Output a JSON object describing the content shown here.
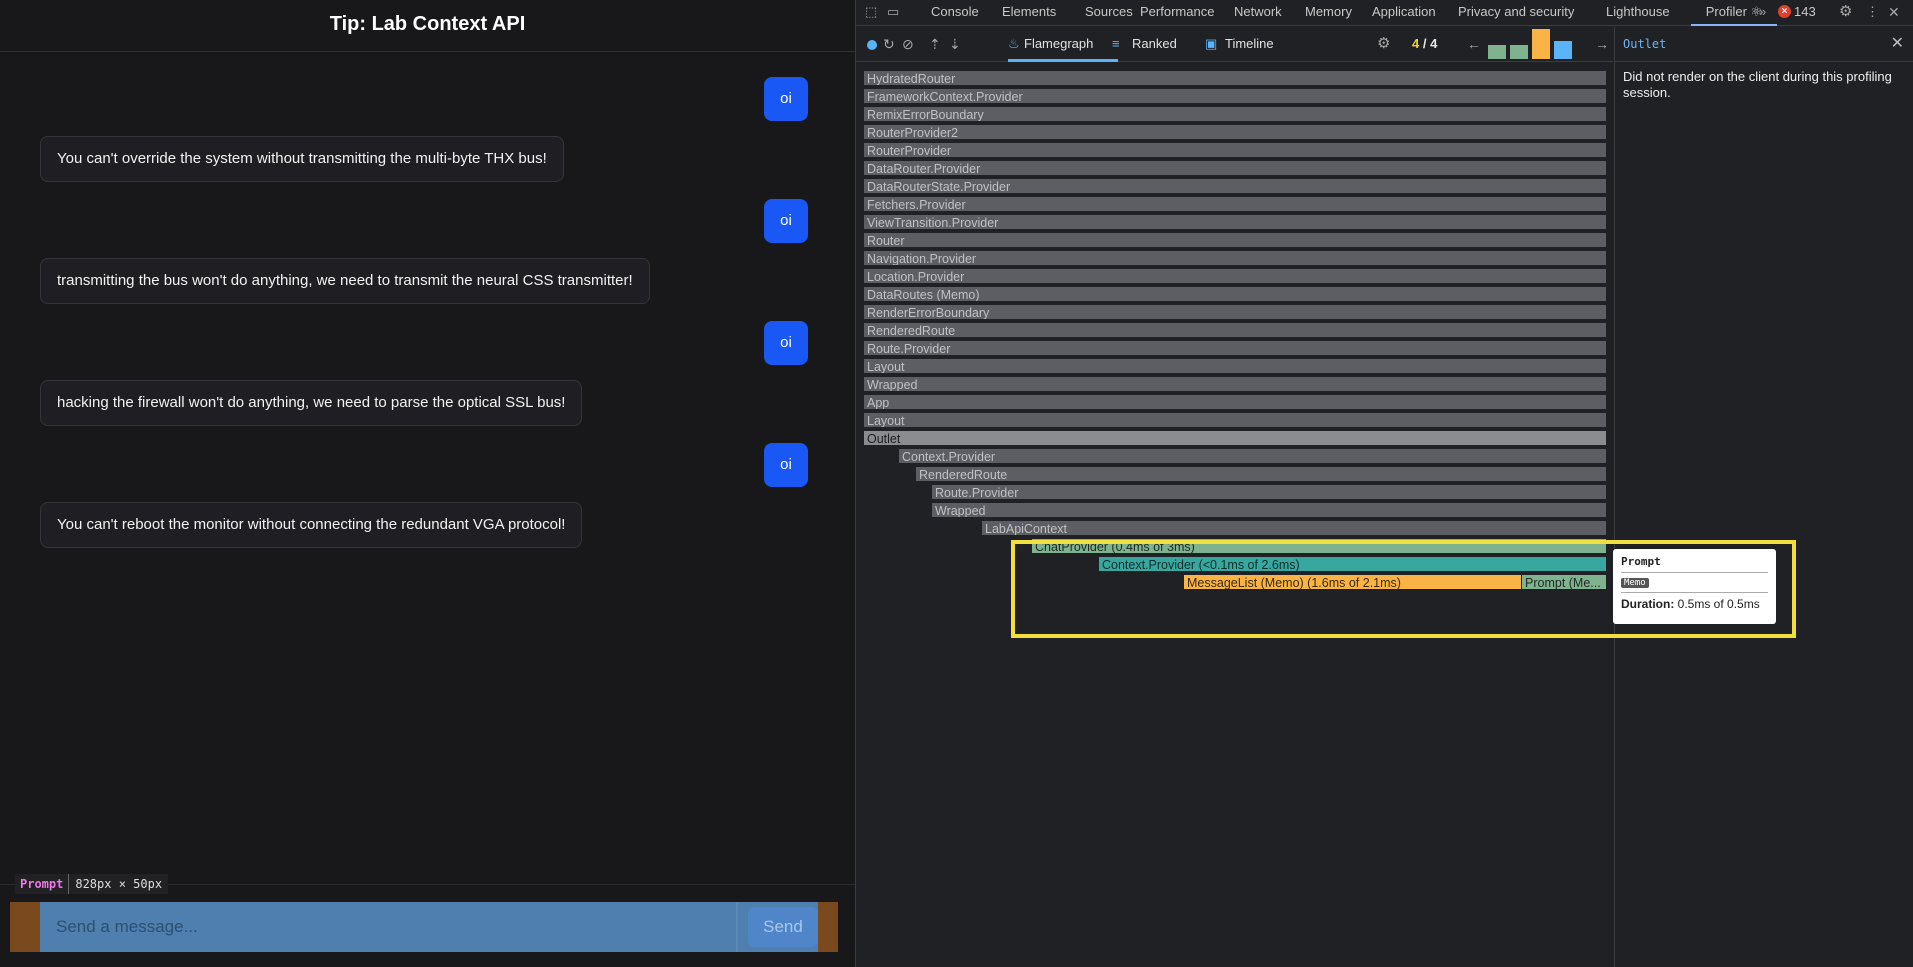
{
  "app": {
    "title": "Tip: Lab Context API",
    "messages": [
      {
        "role": "user",
        "text": "oi"
      },
      {
        "role": "bot",
        "text": "You can't override the system without transmitting the multi-byte THX bus!"
      },
      {
        "role": "user",
        "text": "oi"
      },
      {
        "role": "bot",
        "text": "transmitting the bus won't do anything, we need to transmit the neural CSS transmitter!"
      },
      {
        "role": "user",
        "text": "oi"
      },
      {
        "role": "bot",
        "text": "hacking the firewall won't do anything, we need to parse the optical SSL bus!"
      },
      {
        "role": "user",
        "text": "oi"
      },
      {
        "role": "bot",
        "text": "You can't reboot the monitor without connecting the redundant VGA protocol!"
      }
    ],
    "inspect": {
      "name": "Prompt",
      "size": "828px × 50px"
    },
    "composer": {
      "placeholder": "Send a message...",
      "send_label": "Send"
    }
  },
  "devtools": {
    "tabs": [
      "Console",
      "Elements",
      "Sources",
      "Performance",
      "Network",
      "Memory",
      "Application",
      "Privacy and security",
      "Lighthouse",
      "Profiler ⚛"
    ],
    "error_count": "143",
    "profiler": {
      "tabs": [
        "Flamegraph",
        "Ranked",
        "Timeline"
      ],
      "commit_current": "4",
      "commit_sep": "/",
      "commit_total": "4",
      "commit_bars": [
        {
          "height": 0.45,
          "color": "#7fb38f"
        },
        {
          "height": 0.45,
          "color": "#7fb38f"
        },
        {
          "height": 1.0,
          "color": "#f9b445"
        },
        {
          "height": 0.6,
          "color": "#5ab4f8"
        }
      ]
    },
    "sidebar": {
      "title": "Outlet",
      "message": "Did not render on the client during this profiling session."
    },
    "flamegraph": [
      {
        "label": "HydratedRouter",
        "depth": 0,
        "kind": "gray"
      },
      {
        "label": "FrameworkContext.Provider",
        "depth": 0,
        "kind": "gray"
      },
      {
        "label": "RemixErrorBoundary",
        "depth": 0,
        "kind": "gray"
      },
      {
        "label": "RouterProvider2",
        "depth": 0,
        "kind": "gray"
      },
      {
        "label": "RouterProvider",
        "depth": 0,
        "kind": "gray"
      },
      {
        "label": "DataRouter.Provider",
        "depth": 0,
        "kind": "gray"
      },
      {
        "label": "DataRouterState.Provider",
        "depth": 0,
        "kind": "gray"
      },
      {
        "label": "Fetchers.Provider",
        "depth": 0,
        "kind": "gray"
      },
      {
        "label": "ViewTransition.Provider",
        "depth": 0,
        "kind": "gray"
      },
      {
        "label": "Router",
        "depth": 0,
        "kind": "gray"
      },
      {
        "label": "Navigation.Provider",
        "depth": 0,
        "kind": "gray"
      },
      {
        "label": "Location.Provider",
        "depth": 0,
        "kind": "gray"
      },
      {
        "label": "DataRoutes (Memo)",
        "depth": 0,
        "kind": "gray"
      },
      {
        "label": "RenderErrorBoundary",
        "depth": 0,
        "kind": "gray"
      },
      {
        "label": "RenderedRoute",
        "depth": 0,
        "kind": "gray"
      },
      {
        "label": "Route.Provider",
        "depth": 0,
        "kind": "gray"
      },
      {
        "label": "Layout",
        "depth": 0,
        "kind": "gray"
      },
      {
        "label": "Wrapped",
        "depth": 0,
        "kind": "gray"
      },
      {
        "label": "App",
        "depth": 0,
        "kind": "gray"
      },
      {
        "label": "Layout",
        "depth": 0,
        "kind": "gray"
      },
      {
        "label": "Outlet",
        "depth": 0,
        "kind": "gray2"
      },
      {
        "label": "Context.Provider",
        "depth": 1,
        "kind": "gray"
      },
      {
        "label": "RenderedRoute",
        "depth": 2,
        "kind": "gray"
      },
      {
        "label": "Route.Provider",
        "depth": 3,
        "kind": "gray"
      },
      {
        "label": "Wrapped",
        "depth": 3,
        "kind": "gray"
      },
      {
        "label": "LabApiContext",
        "depth": 4,
        "kind": "gray"
      },
      {
        "label": "ChatProvider (0.4ms of 3ms)",
        "depth": 5,
        "kind": "green"
      },
      {
        "label": "Context.Provider (<0.1ms of 2.6ms)",
        "depth": 6,
        "kind": "teal"
      },
      {
        "label": "MessageList (Memo) (1.6ms of 2.1ms)",
        "depth": 7,
        "kind": "orange"
      },
      {
        "label": "Prompt (Me...",
        "depth": 7,
        "kind": "green"
      }
    ],
    "tooltip": {
      "name": "Prompt",
      "badge": "Memo",
      "duration_label": "Duration:",
      "duration_value": "0.5ms of 0.5ms"
    }
  }
}
